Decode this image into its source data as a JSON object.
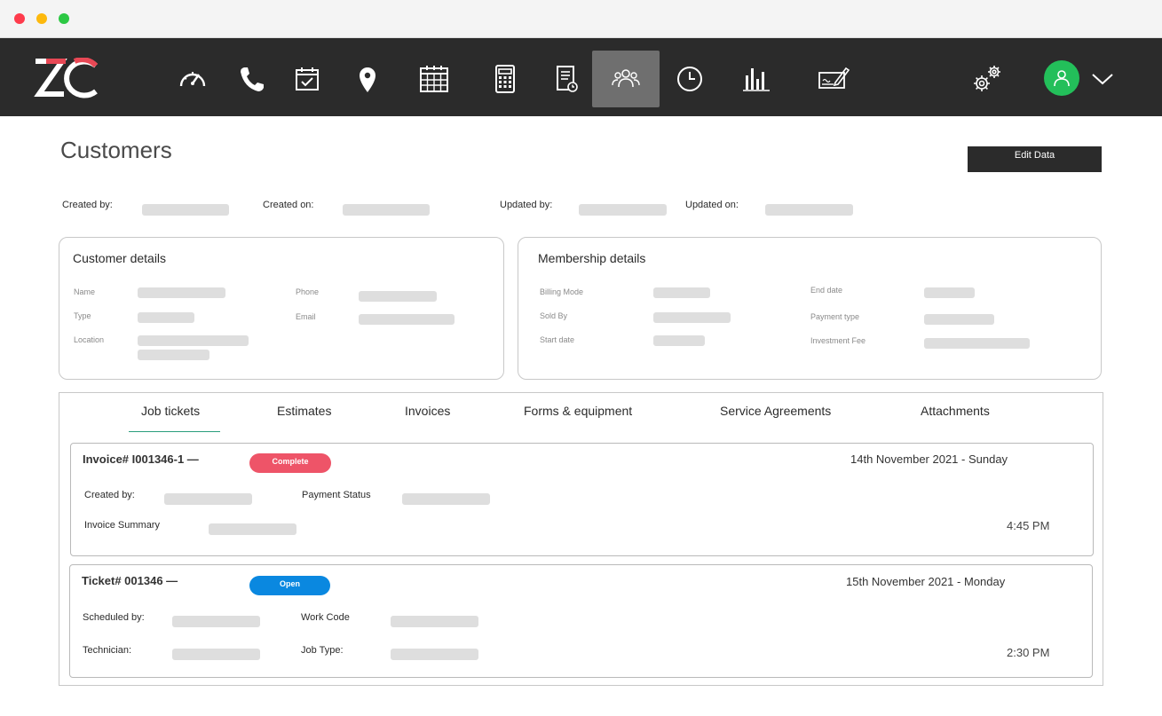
{
  "app": {
    "logo_text": "ZC",
    "nav_icons": [
      "speedometer-icon",
      "phone-icon",
      "calendar-check-icon",
      "location-pin-icon",
      "calendar-grid-icon",
      "calculator-icon",
      "document-clock-icon",
      "customers-icon",
      "clock-icon",
      "bar-chart-icon",
      "check-writing-icon"
    ],
    "active_nav": "customers-icon",
    "accent": "#23bf5a"
  },
  "page": {
    "title": "Customers",
    "edit_button": "Edit Data",
    "meta": {
      "created_by": "Created by:",
      "created_on": "Created on:",
      "updated_by": "Updated by:",
      "updated_on": "Updated on:"
    }
  },
  "customer_details": {
    "title": "Customer details",
    "name": "Name",
    "type": "Type",
    "location": "Location",
    "phone": "Phone",
    "email": "Email"
  },
  "membership_details": {
    "title": "Membership details",
    "billing_mode": "Billing Mode",
    "sold_by": "Sold By",
    "start_date": "Start date",
    "end_date": "End date",
    "payment_type": "Payment type",
    "investment_fee": "Investment Fee"
  },
  "tabs": [
    "Job tickets",
    "Estimates",
    "Invoices",
    "Forms & equipment",
    "Service Agreements",
    "Attachments"
  ],
  "invoice": {
    "title": "Invoice# I001346-1 —",
    "status": "Complete",
    "status_color": "#ee5468",
    "date": "14th November 2021 - Sunday",
    "created_by": "Created by:",
    "payment_status": "Payment Status",
    "summary": "Invoice Summary",
    "time": "4:45 PM"
  },
  "ticket": {
    "title": "Ticket# 001346 —",
    "status": "Open",
    "status_color": "#0a88e0",
    "date": "15th November 2021 - Monday",
    "scheduled_by": "Scheduled by:",
    "work_code": "Work Code",
    "technician": "Technician:",
    "job_type": "Job Type:",
    "time": "2:30 PM"
  }
}
